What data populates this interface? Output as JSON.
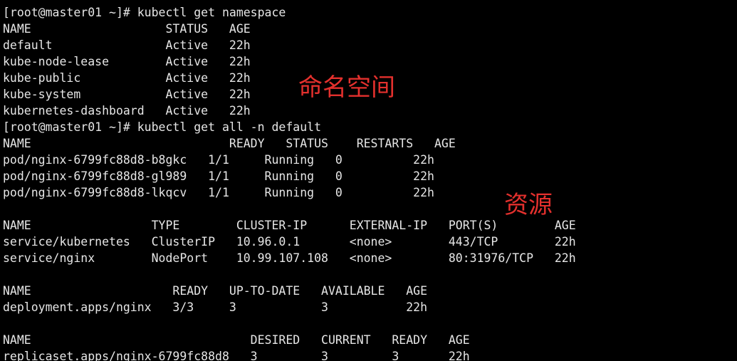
{
  "terminal": {
    "lines": [
      "[root@master01 ~]# kubectl get namespace",
      "NAME                   STATUS   AGE",
      "default                Active   22h",
      "kube-node-lease        Active   22h",
      "kube-public            Active   22h",
      "kube-system            Active   22h",
      "kubernetes-dashboard   Active   22h",
      "[root@master01 ~]# kubectl get all -n default",
      "NAME                            READY   STATUS    RESTARTS   AGE",
      "pod/nginx-6799fc88d8-b8gkc   1/1     Running   0          22h",
      "pod/nginx-6799fc88d8-gl989   1/1     Running   0          22h",
      "pod/nginx-6799fc88d8-lkqcv   1/1     Running   0          22h",
      "",
      "NAME                 TYPE        CLUSTER-IP      EXTERNAL-IP   PORT(S)        AGE",
      "service/kubernetes   ClusterIP   10.96.0.1       <none>        443/TCP        22h",
      "service/nginx        NodePort    10.99.107.108   <none>        80:31976/TCP   22h",
      "",
      "NAME                    READY   UP-TO-DATE   AVAILABLE   AGE",
      "deployment.apps/nginx   3/3     3            3           22h",
      "",
      "NAME                               DESIRED   CURRENT   READY   AGE",
      "replicaset.apps/nginx-6799fc88d8   3         3         3       22h"
    ]
  },
  "annotations": {
    "namespace": "命名空间",
    "resources": "资源"
  },
  "colors": {
    "background": "#000000",
    "text": "#e6e6e6",
    "annotation": "#e3302d"
  }
}
